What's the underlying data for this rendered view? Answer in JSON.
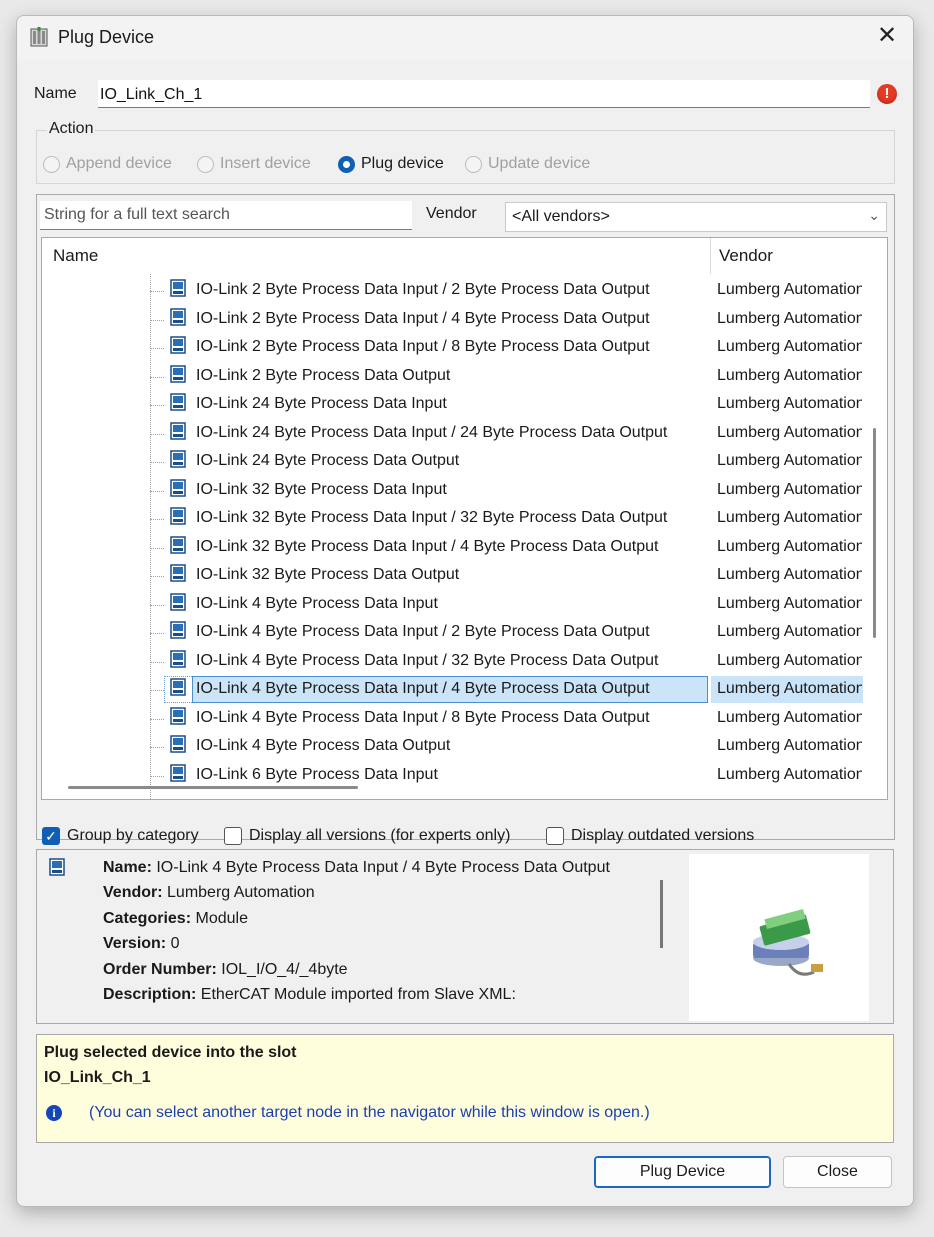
{
  "window": {
    "title": "Plug Device"
  },
  "name": {
    "label": "Name",
    "value": "IO_Link_Ch_1"
  },
  "action": {
    "label": "Action",
    "options": [
      {
        "label": "Append device",
        "selected": false,
        "enabled": false
      },
      {
        "label": "Insert device",
        "selected": false,
        "enabled": false
      },
      {
        "label": "Plug device",
        "selected": true,
        "enabled": true
      },
      {
        "label": "Update device",
        "selected": false,
        "enabled": false
      }
    ]
  },
  "search": {
    "placeholder": "String for a full text search",
    "value": ""
  },
  "vendor_filter": {
    "label": "Vendor",
    "selected": "<All vendors>"
  },
  "tree": {
    "headers": {
      "name": "Name",
      "vendor": "Vendor"
    },
    "rows": [
      {
        "name": "IO-Link 2 Byte Process Data Input / 2 Byte Process Data Output",
        "vendor": "Lumberg Automation"
      },
      {
        "name": "IO-Link 2 Byte Process Data Input / 4 Byte Process Data Output",
        "vendor": "Lumberg Automation"
      },
      {
        "name": "IO-Link 2 Byte Process Data Input / 8 Byte Process Data Output",
        "vendor": "Lumberg Automation"
      },
      {
        "name": "IO-Link 2 Byte Process Data Output",
        "vendor": "Lumberg Automation"
      },
      {
        "name": "IO-Link 24 Byte Process Data Input",
        "vendor": "Lumberg Automation"
      },
      {
        "name": "IO-Link 24 Byte Process Data Input / 24 Byte Process Data Output",
        "vendor": "Lumberg Automation"
      },
      {
        "name": "IO-Link 24 Byte Process Data Output",
        "vendor": "Lumberg Automation"
      },
      {
        "name": "IO-Link 32 Byte Process Data Input",
        "vendor": "Lumberg Automation"
      },
      {
        "name": "IO-Link 32 Byte Process Data Input / 32 Byte Process Data Output",
        "vendor": "Lumberg Automation"
      },
      {
        "name": "IO-Link 32 Byte Process Data Input / 4 Byte Process Data Output",
        "vendor": "Lumberg Automation"
      },
      {
        "name": "IO-Link 32 Byte Process Data Output",
        "vendor": "Lumberg Automation"
      },
      {
        "name": "IO-Link 4 Byte Process Data Input",
        "vendor": "Lumberg Automation"
      },
      {
        "name": "IO-Link 4 Byte Process Data Input / 2 Byte Process Data Output",
        "vendor": "Lumberg Automation"
      },
      {
        "name": "IO-Link 4 Byte Process Data Input / 32 Byte Process Data Output",
        "vendor": "Lumberg Automation"
      },
      {
        "name": "IO-Link 4 Byte Process Data Input / 4 Byte Process Data Output",
        "vendor": "Lumberg Automation",
        "selected": true
      },
      {
        "name": "IO-Link 4 Byte Process Data Input / 8 Byte Process Data Output",
        "vendor": "Lumberg Automation"
      },
      {
        "name": "IO-Link 4 Byte Process Data Output",
        "vendor": "Lumberg Automation"
      },
      {
        "name": "IO-Link 6 Byte Process Data Input",
        "vendor": "Lumberg Automation"
      }
    ]
  },
  "options": [
    {
      "label": "Group by category",
      "checked": true
    },
    {
      "label": "Display all versions (for experts only)",
      "checked": false
    },
    {
      "label": "Display outdated versions",
      "checked": false
    }
  ],
  "details": {
    "name_label": "Name:",
    "name_value": "IO-Link 4 Byte Process Data Input / 4 Byte Process Data Output",
    "vendor_label": "Vendor:",
    "vendor_value": "Lumberg Automation",
    "categories_label": "Categories:",
    "categories_value": "Module",
    "version_label": "Version:",
    "version_value": "0",
    "order_label": "Order Number:",
    "order_value": "IOL_I/O_4/_4byte",
    "description_label": "Description:",
    "description_value": "EtherCAT Module imported from Slave XML:"
  },
  "hint": {
    "line1": "Plug selected device into the slot",
    "line2": "IO_Link_Ch_1",
    "note": "(You can select another target node in the navigator while this window is open.)"
  },
  "buttons": {
    "plug": "Plug Device",
    "close": "Close"
  },
  "colors": {
    "accent": "#0f5fb5",
    "selection": "#cce4f7",
    "error": "#e53a24",
    "hint_bg": "#fefedc",
    "link": "#1c3fb0"
  },
  "icons": {
    "title": "plug-device-icon",
    "error": "error-icon",
    "device": "device-module-icon",
    "info": "info-icon",
    "close": "close-icon"
  }
}
